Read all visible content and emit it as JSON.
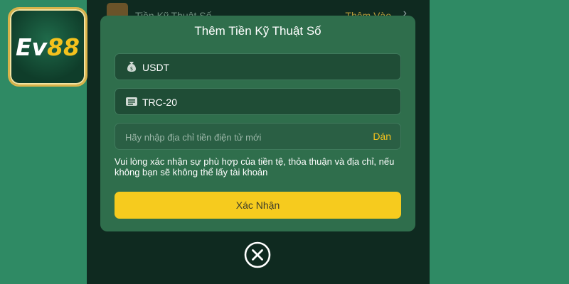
{
  "background": {
    "row_title": "Tiền Kỹ Thuật Số",
    "row_action": "Thêm Vào"
  },
  "logo": {
    "text_main": "Ev",
    "text_accent": "88"
  },
  "modal": {
    "title": "Thêm Tiền Kỹ Thuật Số",
    "currency_icon": "money-bag-icon",
    "currency_value": "USDT",
    "network_icon": "list-icon",
    "network_value": "TRC-20",
    "address_placeholder": "Hãy nhập địa chỉ tiền điện tử mới",
    "paste_label": "Dán",
    "notice": "Vui lòng xác nhận sự phù hợp của tiền tệ, thỏa thuận và địa chỉ, nếu không bạn sẽ không thể lấy tài khoản",
    "confirm_label": "Xác Nhận"
  },
  "colors": {
    "page_bg": "#2f8a64",
    "panel_bg": "#0f2a20",
    "modal_bg": "#2f6e4c",
    "field_bg": "#1f4d36",
    "accent_yellow": "#f6cb1e"
  }
}
